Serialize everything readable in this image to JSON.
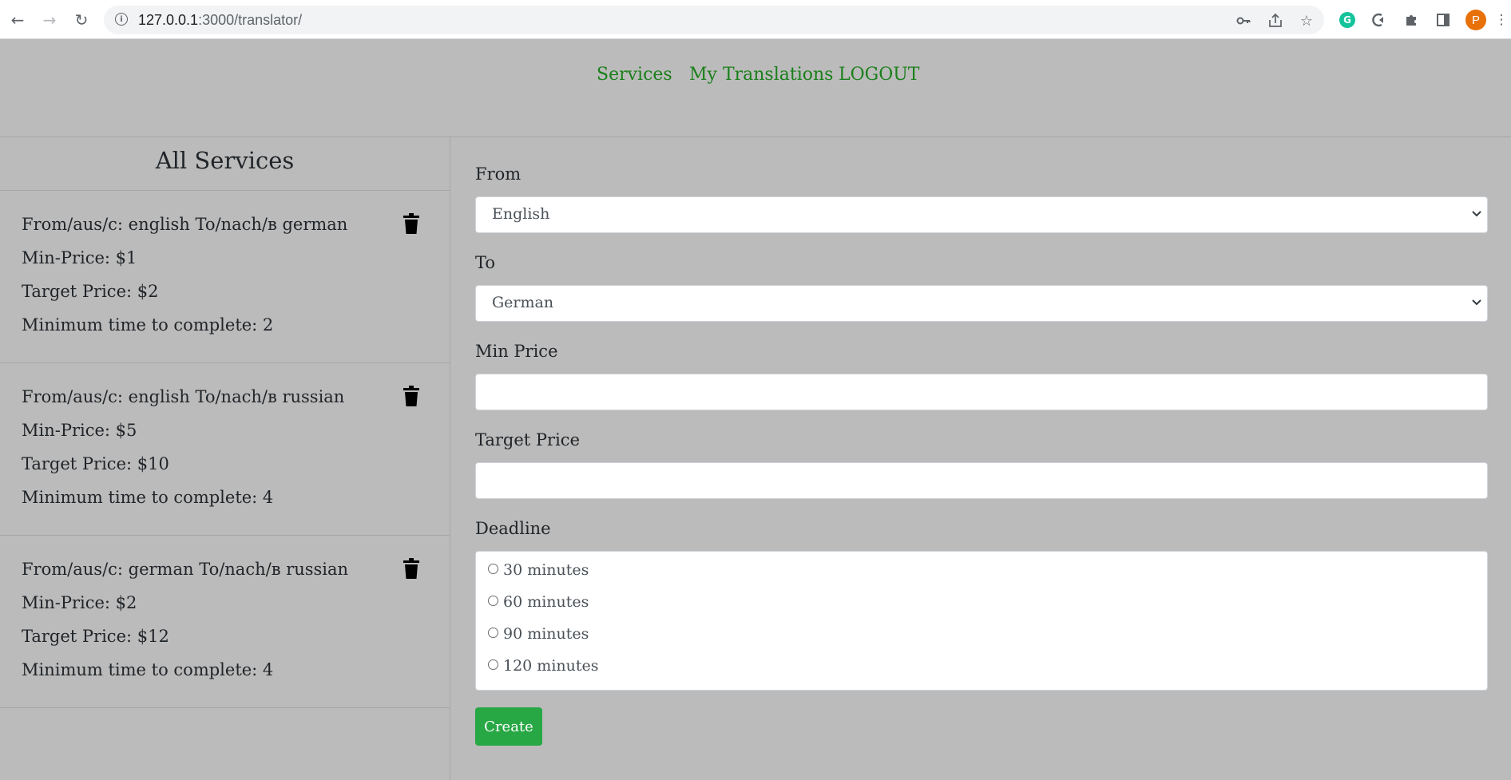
{
  "browser": {
    "url_host": "127.0.0.1",
    "url_rest": ":3000/translator/",
    "avatar_letter": "P",
    "grammarly_letter": "G"
  },
  "nav": {
    "services": "Services",
    "my_translations": "My Translations",
    "logout": "LOGOUT",
    "link_color": "#1a7f1a"
  },
  "sidebar": {
    "title": "All Services",
    "services": [
      {
        "route": "From/aus/c: english To/nach/в german",
        "min_price": "Min-Price: $1",
        "target_price": "Target Price: $2",
        "min_time": "Minimum time to complete: 2"
      },
      {
        "route": "From/aus/c: english To/nach/в russian",
        "min_price": "Min-Price: $5",
        "target_price": "Target Price: $10",
        "min_time": "Minimum time to complete: 4"
      },
      {
        "route": "From/aus/c: german To/nach/в russian",
        "min_price": "Min-Price: $2",
        "target_price": "Target Price: $12",
        "min_time": "Minimum time to complete: 4"
      }
    ]
  },
  "form": {
    "from_label": "From",
    "from_value": "English",
    "to_label": "To",
    "to_value": "German",
    "min_price_label": "Min Price",
    "min_price_value": "",
    "target_price_label": "Target Price",
    "target_price_value": "",
    "deadline_label": "Deadline",
    "deadline_options": [
      "30 minutes",
      "60 minutes",
      "90 minutes",
      "120 minutes"
    ],
    "create_label": "Create",
    "create_color": "#28a745"
  }
}
